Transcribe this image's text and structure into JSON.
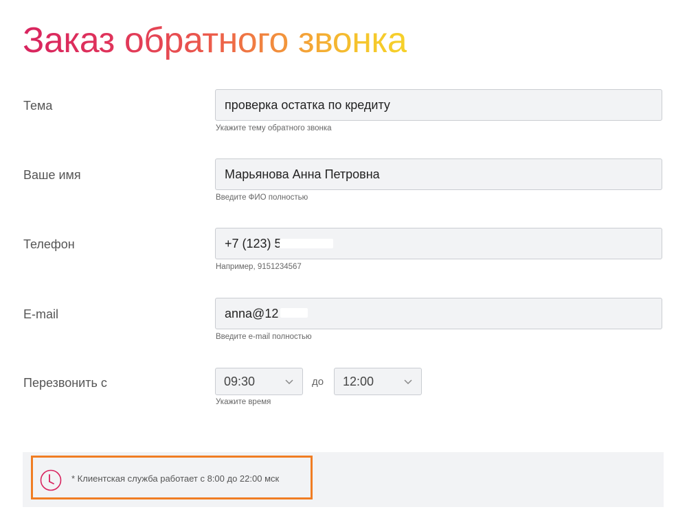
{
  "header": {
    "title": "Заказ обратного звонка"
  },
  "form": {
    "topic": {
      "label": "Тема",
      "value": "проверка остатка по кредиту",
      "hint": "Укажите тему обратного звонка"
    },
    "name": {
      "label": "Ваше имя",
      "value": "Марьянова Анна Петровна",
      "hint": "Введите ФИО полностью"
    },
    "phone": {
      "label": "Телефон",
      "value": "+7 (123) 5",
      "hint": "Например, 9151234567"
    },
    "email": {
      "label": "E-mail",
      "value": "anna@12",
      "hint": "Введите e-mail полностью"
    },
    "callback": {
      "label": "Перезвонить с",
      "from": "09:30",
      "separator": "до",
      "to": "12:00",
      "hint": "Укажите время"
    }
  },
  "info": {
    "icon": "clock-info-icon",
    "text": "* Клиентская служба работает с 8:00 до 22:00 мск",
    "highlight_color": "#f07d23",
    "accent_color": "#d8245f"
  },
  "colors": {
    "title_gradient_start": "#d8245f",
    "title_gradient_end": "#f6d12a"
  }
}
